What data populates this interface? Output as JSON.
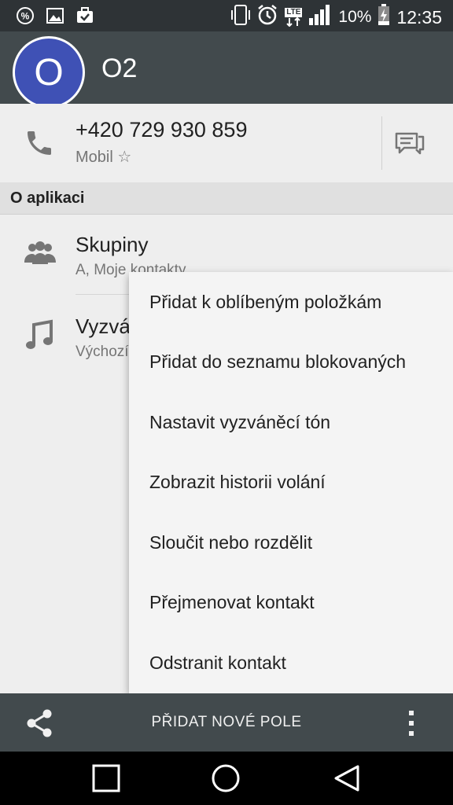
{
  "status_bar": {
    "icons": [
      "percent-icon",
      "image-icon",
      "briefcase-icon",
      "vibrate-icon",
      "alarm-icon",
      "lte-icon",
      "signal-icon",
      "battery-icon"
    ],
    "network": "LTE",
    "battery": "10%",
    "time": "12:35"
  },
  "contact": {
    "avatar_letter": "O",
    "name": "O2",
    "avatar_color": "#3f51b5"
  },
  "phone": {
    "number": "+420 729 930 859",
    "type": "Mobil ☆"
  },
  "section": {
    "title": "O aplikaci"
  },
  "rows": {
    "groups": {
      "title": "Skupiny",
      "subtitle": "A, Moje kontakty"
    },
    "ringtone": {
      "title": "Vyzváněcí tón",
      "subtitle": "Výchozí"
    }
  },
  "menu": {
    "items": [
      "Přidat k oblíbeným položkám",
      "Přidat do seznamu blokovaných",
      "Nastavit vyzváněcí tón",
      "Zobrazit historii volání",
      "Sloučit nebo rozdělit",
      "Přejmenovat kontakt",
      "Odstranit kontakt"
    ]
  },
  "bottom_bar": {
    "add_field_label": "PŘIDAT NOVÉ POLE"
  },
  "colors": {
    "app_bar": "#424a4d",
    "status_bar": "#2e3336",
    "background": "#eeeeee"
  }
}
